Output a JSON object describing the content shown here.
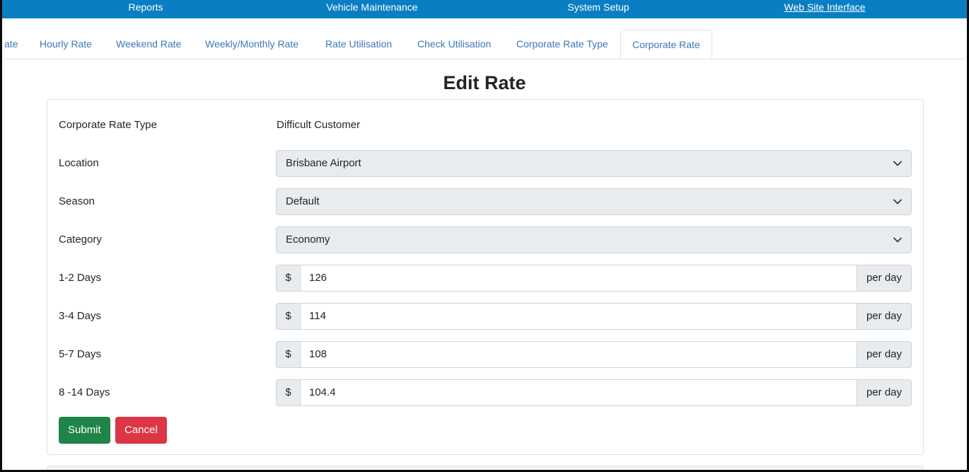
{
  "topnav": {
    "items": [
      {
        "label": "Reports"
      },
      {
        "label": "Vehicle Maintenance"
      },
      {
        "label": "System Setup"
      },
      {
        "label": "Web Site Interface"
      }
    ]
  },
  "tabs": [
    {
      "label": "ate"
    },
    {
      "label": "Hourly Rate"
    },
    {
      "label": "Weekend Rate"
    },
    {
      "label": "Weekly/Monthly Rate"
    },
    {
      "label": "Rate Utilisation"
    },
    {
      "label": "Check Utilisation"
    },
    {
      "label": "Corporate Rate Type"
    },
    {
      "label": "Corporate Rate",
      "active": true
    }
  ],
  "page": {
    "title": "Edit Rate"
  },
  "form": {
    "corporate_rate_type": {
      "label": "Corporate Rate Type",
      "value": "Difficult Customer"
    },
    "location": {
      "label": "Location",
      "value": "Brisbane Airport"
    },
    "season": {
      "label": "Season",
      "value": "Default"
    },
    "category": {
      "label": "Category",
      "value": "Economy"
    },
    "currency_symbol": "$",
    "rate_suffix": "per day",
    "rates": [
      {
        "label": "1-2 Days",
        "value": "126"
      },
      {
        "label": "3-4 Days",
        "value": "114"
      },
      {
        "label": "5-7 Days",
        "value": "108"
      },
      {
        "label": "8 -14 Days",
        "value": "104.4"
      }
    ],
    "submit_label": "Submit",
    "cancel_label": "Cancel"
  },
  "colors": {
    "topbar": "#0a7ec2",
    "tab_link": "#3a78b8",
    "submit": "#1e8449",
    "cancel": "#dc3545"
  },
  "icons": {
    "select_indicator": "chevron-down-icon"
  }
}
